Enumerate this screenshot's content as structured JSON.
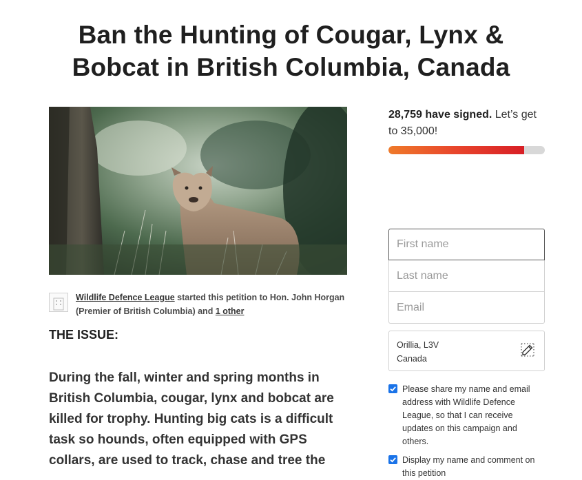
{
  "petition": {
    "title_line1": "Ban the Hunting of Cougar, Lynx &",
    "title_line2": "Bobcat in British Columbia, Canada",
    "hero_image_alt": "cougar-in-forest",
    "starter": {
      "org": "Wildlife Defence League",
      "mid_text": " started this petition to Hon. John Horgan (Premier of British Columbia) and ",
      "other_link": "1 other"
    },
    "issue_heading": "THE ISSUE:",
    "body": "During the fall, winter and spring months in British Columbia, cougar, lynx and bobcat are killed for trophy. Hunting big cats is a difficult task so hounds, often equipped with GPS collars, are used to track, chase and tree the"
  },
  "signatures": {
    "count_text": "28,759 have signed.",
    "goal_text": " Let’s get to 35,000!",
    "count": 28759,
    "goal": 35000,
    "progress_fraction": 0.87
  },
  "form": {
    "first_name_placeholder": "First name",
    "last_name_placeholder": "Last name",
    "email_placeholder": "Email",
    "location_line1": "Orillia, L3V",
    "location_line2": "Canada",
    "share_consent": "Please share my name and email address with Wildlife Defence League, so that I can receive updates on this campaign and others.",
    "display_consent": "Display my name and comment on this petition"
  },
  "colors": {
    "progress_start": "#ef7a2a",
    "progress_end": "#d81f26",
    "checkbox": "#1a73e8"
  }
}
